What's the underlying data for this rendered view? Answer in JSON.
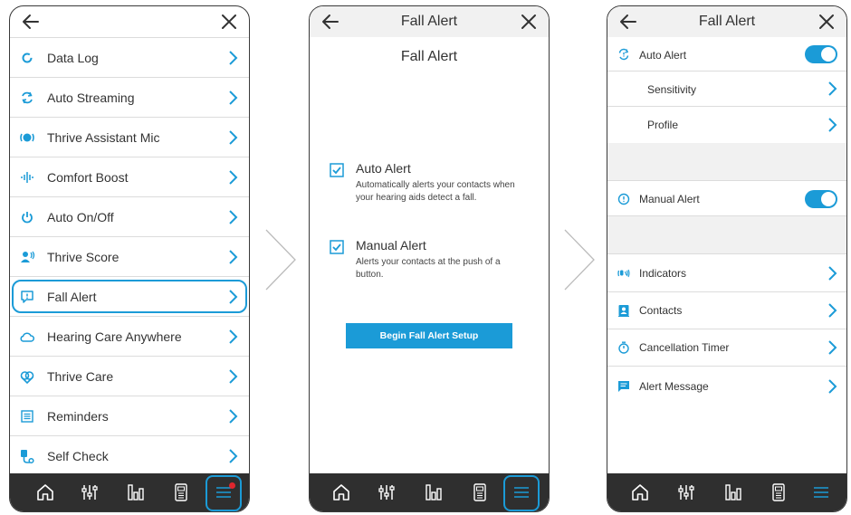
{
  "phone1": {
    "menu": [
      {
        "label": "Data Log",
        "icon": "data-log-icon"
      },
      {
        "label": "Auto Streaming",
        "icon": "auto-streaming-icon"
      },
      {
        "label": "Thrive Assistant Mic",
        "icon": "assistant-mic-icon"
      },
      {
        "label": "Comfort Boost",
        "icon": "comfort-boost-icon"
      },
      {
        "label": "Auto On/Off",
        "icon": "power-icon"
      },
      {
        "label": "Thrive Score",
        "icon": "thrive-score-icon"
      },
      {
        "label": "Fall Alert",
        "icon": "fall-alert-icon",
        "highlighted": true
      },
      {
        "label": "Hearing Care Anywhere",
        "icon": "cloud-icon"
      },
      {
        "label": "Thrive Care",
        "icon": "heart-icon"
      },
      {
        "label": "Reminders",
        "icon": "reminders-icon"
      },
      {
        "label": "Self Check",
        "icon": "self-check-icon"
      }
    ],
    "nav_active": "menu-icon",
    "nav_notification": true
  },
  "phone2": {
    "title": "Fall Alert",
    "heading": "Fall Alert",
    "options": [
      {
        "title": "Auto Alert",
        "description": "Automatically alerts your contacts when your hearing aids detect a fall.",
        "checked": true
      },
      {
        "title": "Manual Alert",
        "description": "Alerts your contacts at the push of a button.",
        "checked": true
      }
    ],
    "button_label": "Begin Fall Alert Setup"
  },
  "phone3": {
    "title": "Fall Alert",
    "auto_alert": {
      "label": "Auto Alert",
      "enabled": true
    },
    "sensitivity": "Sensitivity",
    "profile": "Profile",
    "manual_alert": {
      "label": "Manual Alert",
      "enabled": true
    },
    "indicators": "Indicators",
    "contacts": "Contacts",
    "cancellation_timer": "Cancellation Timer",
    "alert_message": "Alert Message"
  },
  "colors": {
    "accent": "#1b9bd7",
    "navbar": "#2f2f2f",
    "notification": "#e0262e",
    "panel_gray": "#f1f1f1"
  }
}
